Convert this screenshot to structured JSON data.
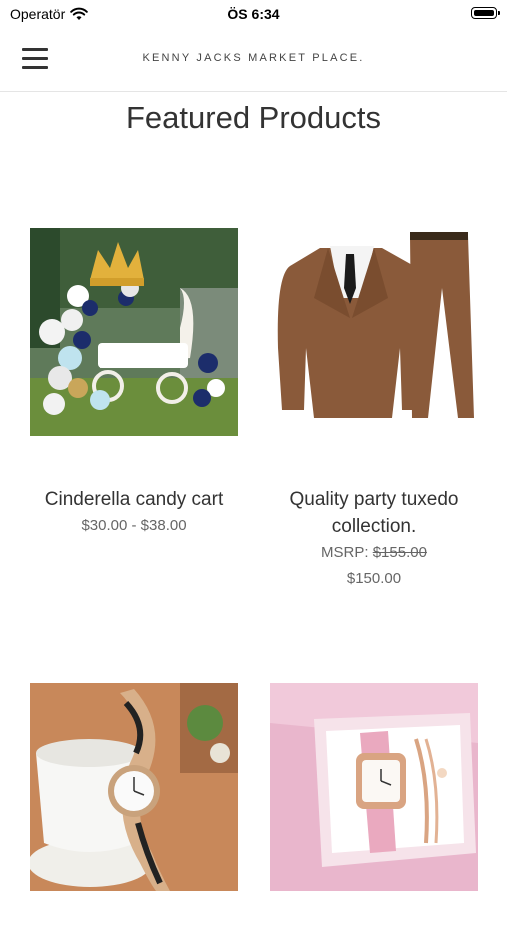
{
  "status_bar": {
    "carrier": "Operatör",
    "time": "ÖS 6:34"
  },
  "header": {
    "title": "KENNY JACKS MARKET PLACE."
  },
  "section": {
    "title": "Featured Products"
  },
  "products": [
    {
      "name": "Cinderella candy cart",
      "price": "$30.00 - $38.00"
    },
    {
      "name": "Quality party tuxedo collection.",
      "msrp_label": "MSRP:",
      "msrp_value": "$155.00",
      "price": "$150.00"
    },
    {
      "name": "",
      "price": ""
    },
    {
      "name": "",
      "price": ""
    }
  ],
  "icons": {
    "menu": "hamburger-menu-icon",
    "wifi": "wifi-icon",
    "battery": "battery-icon"
  }
}
